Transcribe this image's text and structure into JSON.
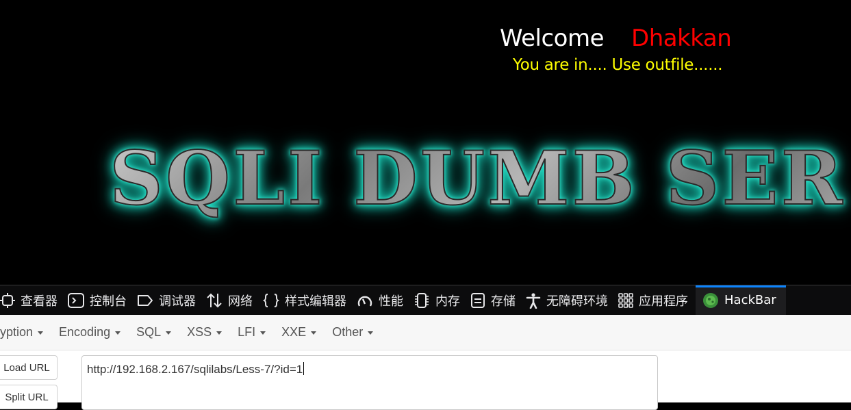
{
  "page": {
    "welcome_label": "Welcome",
    "username": "Dhakkan",
    "message": "You are in.... Use outfile......",
    "banner_text": "SQLI DUMB SER"
  },
  "devtools": {
    "tabs": [
      {
        "label": "查看器",
        "icon": "inspector-icon"
      },
      {
        "label": "控制台",
        "icon": "console-icon"
      },
      {
        "label": "调试器",
        "icon": "debugger-icon"
      },
      {
        "label": "网络",
        "icon": "network-icon"
      },
      {
        "label": "样式编辑器",
        "icon": "style-editor-icon"
      },
      {
        "label": "性能",
        "icon": "performance-icon"
      },
      {
        "label": "内存",
        "icon": "memory-icon"
      },
      {
        "label": "存储",
        "icon": "storage-icon"
      },
      {
        "label": "无障碍环境",
        "icon": "accessibility-icon"
      },
      {
        "label": "应用程序",
        "icon": "application-icon"
      },
      {
        "label": "HackBar",
        "icon": "hackbar-icon"
      }
    ],
    "accent": "#0a84ff"
  },
  "hackbar": {
    "menu": [
      "ryption",
      "Encoding",
      "SQL",
      "XSS",
      "LFI",
      "XXE",
      "Other"
    ],
    "load_url_label": "Load URL",
    "split_url_label": "Split URL",
    "url_value": "http://192.168.2.167/sqlilabs/Less-7/?id=1"
  },
  "colors": {
    "welcome": "#ffffff",
    "username": "#ff0000",
    "message": "#ffff00",
    "banner_glow": "#2fe8d0"
  }
}
